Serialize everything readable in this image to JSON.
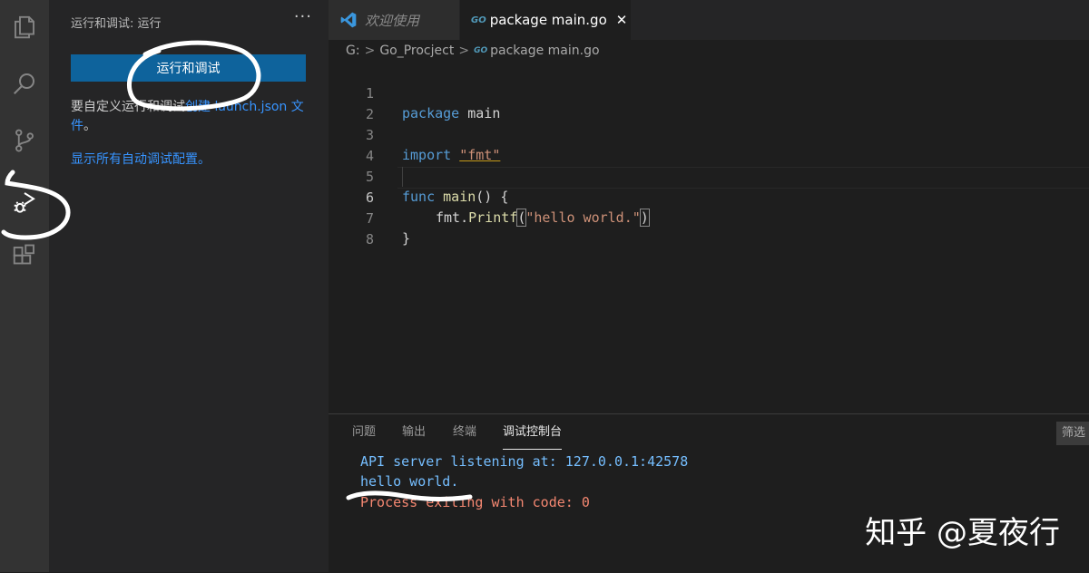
{
  "activity_bar": {
    "icons": [
      "files-icon",
      "search-icon",
      "source-control-icon",
      "run-debug-icon",
      "extensions-icon"
    ]
  },
  "sidebar": {
    "title": "运行和调试: 运行",
    "more": "···",
    "run_button": "运行和调试",
    "text_before_link": "要自定义运行和调试",
    "create_link": "创建 launch.json 文件",
    "text_after_link": "。",
    "show_all_link": "显示所有自动调试配置。"
  },
  "tabs": [
    {
      "label": "欢迎使用",
      "active": false
    },
    {
      "label": "package main.go",
      "active": true,
      "icon": "GO",
      "close": "✕"
    }
  ],
  "breadcrumb": {
    "drive": "G:",
    "folder": "Go_Procject",
    "file_icon": "GO",
    "file": "package main.go",
    "separator": ">"
  },
  "editor": {
    "line_numbers": [
      "1",
      "2",
      "3",
      "4",
      "5",
      "6",
      "7",
      "8"
    ],
    "active_line": "6",
    "code": {
      "l1_kw": "package",
      "l1_name": "main",
      "l3_kw": "import",
      "l3_str": "\"fmt\"",
      "l5_kw": "func",
      "l5_fn": "main",
      "l5_rest": "() {",
      "l6_pkg": "fmt.",
      "l6_fn": "Printf",
      "l6_open": "(",
      "l6_str": "\"hello world.\"",
      "l6_close": ")",
      "l7": "}"
    }
  },
  "panel": {
    "tabs": [
      "问题",
      "输出",
      "终端",
      "调试控制台"
    ],
    "active_tab": "调试控制台",
    "filter_label": "筛选",
    "console": [
      {
        "text": "API server listening at: 127.0.0.1:42578",
        "kind": "info"
      },
      {
        "text": "hello world.",
        "kind": "info"
      },
      {
        "text": "Process exiting with code: 0",
        "kind": "error"
      }
    ]
  },
  "watermark": "知乎 @夏夜行",
  "colors": {
    "accent": "#0e639c",
    "link": "#3794ff",
    "keyword": "#569cd6",
    "function": "#dcdcaa",
    "string": "#ce9178",
    "console_info": "#75beff",
    "console_error": "#f48771"
  }
}
